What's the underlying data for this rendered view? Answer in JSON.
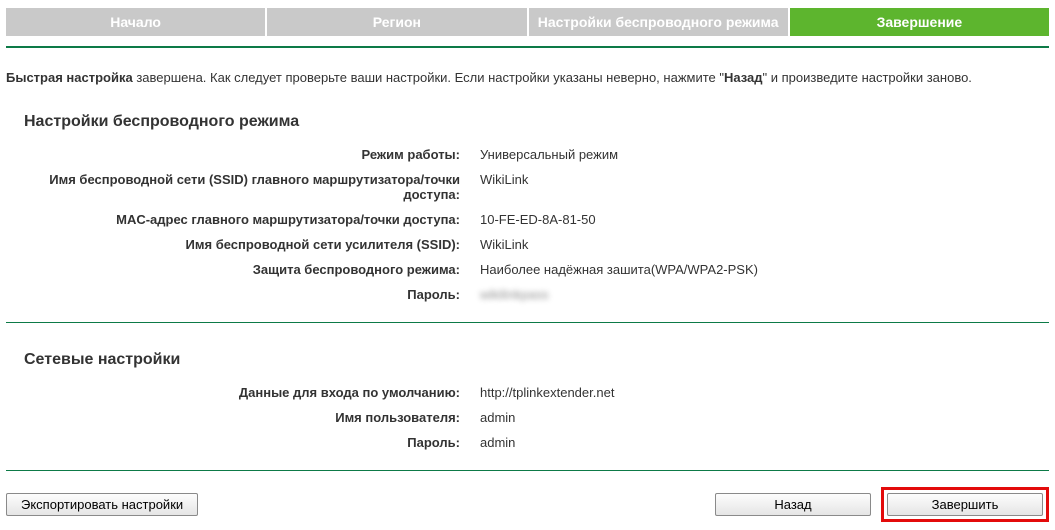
{
  "tabs": {
    "start": "Начало",
    "region": "Регион",
    "wireless": "Настройки беспроводного режима",
    "finish": "Завершение"
  },
  "summary": {
    "prefix_bold": "Быстрая настройка",
    "mid1": " завершена. Как следует проверьте ваши настройки. Если настройки указаны неверно, нажмите \"",
    "back_bold": "Назад",
    "mid2": "\" и произведите настройки заново."
  },
  "wireless_section": {
    "title": "Настройки беспроводного режима",
    "rows": {
      "mode_label": "Режим работы:",
      "mode_value": "Универсальный режим",
      "root_ssid_label": "Имя беспроводной сети (SSID) главного маршрутизатора/точки доступа:",
      "root_ssid_value": "WikiLink",
      "root_mac_label": "MAC-адрес главного маршрутизатора/точки доступа:",
      "root_mac_value": "10-FE-ED-8A-81-50",
      "ext_ssid_label": "Имя беспроводной сети усилителя (SSID):",
      "ext_ssid_value": "WikiLink",
      "security_label": "Защита беспроводного режима:",
      "security_value": "Наиболее надёжная зашита(WPA/WPA2-PSK)",
      "password_label": "Пароль:",
      "password_value": "wikilinkpass"
    }
  },
  "network_section": {
    "title": "Сетевые настройки",
    "rows": {
      "login_label": "Данные для входа по умолчанию:",
      "login_value": "http://tplinkextender.net",
      "user_label": "Имя пользователя:",
      "user_value": "admin",
      "pass_label": "Пароль:",
      "pass_value": "admin"
    }
  },
  "buttons": {
    "export": "Экспортировать настройки",
    "back": "Назад",
    "finish": "Завершить"
  }
}
